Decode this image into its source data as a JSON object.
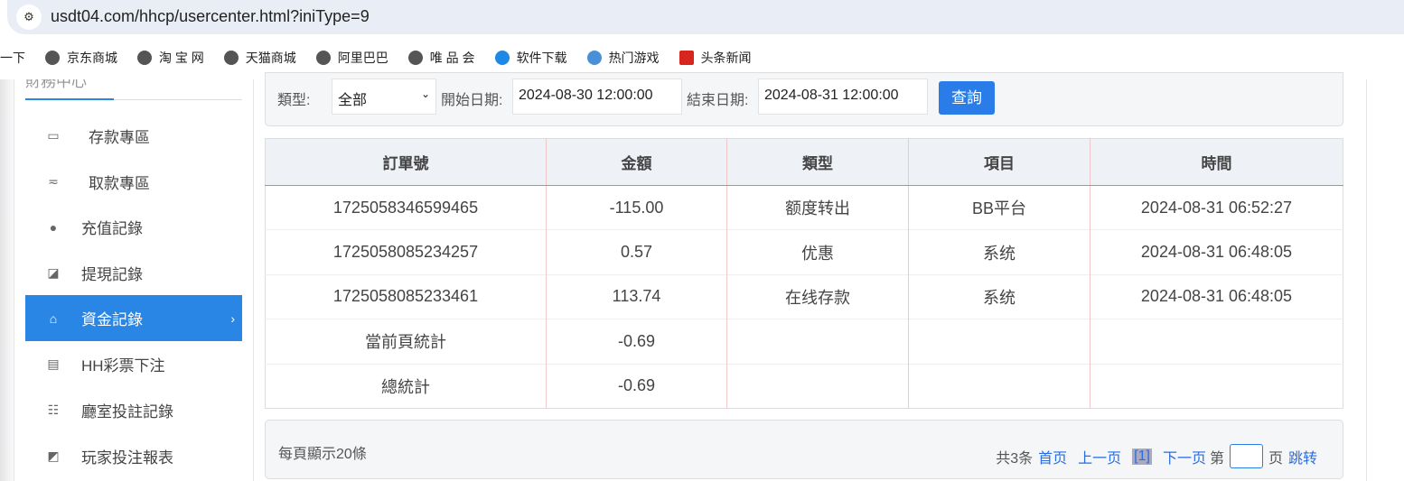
{
  "browser": {
    "url": "usdt04.com/hhcp/usercenter.html?iniType=9",
    "bookmarks": [
      "一下",
      "京东商城",
      "淘 宝 网",
      "天猫商城",
      "阿里巴巴",
      "唯 品 会",
      "软件下载",
      "热门游戏",
      "头条新闻"
    ]
  },
  "sidebar": {
    "title": "財務中心",
    "items": [
      {
        "label": "存款專區",
        "icon": "card-icon"
      },
      {
        "label": "取款專區",
        "icon": "hand-money-icon"
      },
      {
        "label": "充值記錄",
        "icon": "money-bag-icon"
      },
      {
        "label": "提現記錄",
        "icon": "wallet-icon"
      },
      {
        "label": "資金記錄",
        "icon": "funds-icon",
        "active": true
      },
      {
        "label": "HH彩票下注",
        "icon": "ticket-icon"
      },
      {
        "label": "廳室投註記錄",
        "icon": "list-icon"
      },
      {
        "label": "玩家投注報表",
        "icon": "chart-icon"
      }
    ]
  },
  "filter": {
    "type_label": "類型:",
    "type_value": "全部",
    "start_label": "開始日期:",
    "start_value": "2024-08-30 12:00:00",
    "end_label": "結束日期:",
    "end_value": "2024-08-31 12:00:00",
    "query": "查詢"
  },
  "table": {
    "headers": [
      "訂單號",
      "金額",
      "類型",
      "項目",
      "時間"
    ],
    "rows": [
      [
        "1725058346599465",
        "-115.00",
        "额度转出",
        "BB平台",
        "2024-08-31 06:52:27"
      ],
      [
        "1725058085234257",
        "0.57",
        "优惠",
        "系统",
        "2024-08-31 06:48:05"
      ],
      [
        "1725058085233461",
        "113.74",
        "在线存款",
        "系统",
        "2024-08-31 06:48:05"
      ],
      [
        "當前頁統計",
        "-0.69",
        "",
        "",
        ""
      ],
      [
        "總統計",
        "-0.69",
        "",
        "",
        ""
      ]
    ]
  },
  "footer": {
    "per_page": "每頁顯示20條",
    "total": "共3条",
    "first": "首页",
    "prev": "上一页",
    "current": "[1]",
    "next": "下一页",
    "page_prefix": "第",
    "page_suffix": "页",
    "jump": "跳转"
  },
  "colors": {
    "accent": "#2a86e4"
  }
}
